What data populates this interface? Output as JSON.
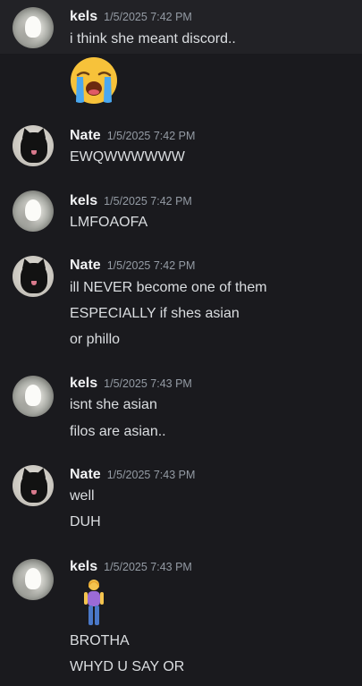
{
  "messages": [
    {
      "user": "kels",
      "timestamp": "1/5/2025 7:42 PM",
      "lines": [
        "i think she meant discord.."
      ],
      "emoji": "loudly-crying-face-emoji"
    },
    {
      "user": "Nate",
      "timestamp": "1/5/2025 7:42 PM",
      "lines": [
        "EWQWWWWWW"
      ]
    },
    {
      "user": "kels",
      "timestamp": "1/5/2025 7:42 PM",
      "lines": [
        "LMFOAOFA"
      ]
    },
    {
      "user": "Nate",
      "timestamp": "1/5/2025 7:42 PM",
      "lines": [
        "ill NEVER become one of them",
        "ESPECIALLY if shes asian",
        "or phillo"
      ]
    },
    {
      "user": "kels",
      "timestamp": "1/5/2025 7:43 PM",
      "lines": [
        "isnt she asian",
        "filos are asian.."
      ]
    },
    {
      "user": "Nate",
      "timestamp": "1/5/2025 7:43 PM",
      "lines": [
        "well",
        "DUH"
      ]
    },
    {
      "user": "kels",
      "timestamp": "1/5/2025 7:43 PM",
      "emoji": "person-standing-emoji",
      "lines": [
        "BROTHA",
        "WHYD U SAY OR"
      ]
    }
  ],
  "colors": {
    "background": "#1a1a1e",
    "hover_background": "#222226",
    "username": "#f2f3f5",
    "text": "#dbdee1",
    "timestamp": "#949ba4"
  }
}
